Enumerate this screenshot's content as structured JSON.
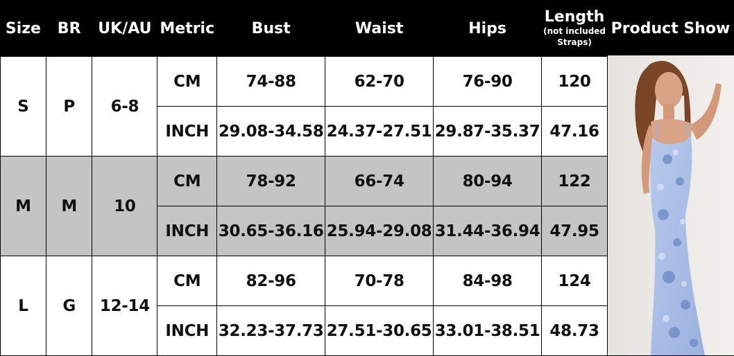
{
  "headers": {
    "size": "Size",
    "br": "BR",
    "ukau": "UK/AU",
    "metric": "Metric",
    "bust": "Bust",
    "waist": "Waist",
    "hips": "Hips",
    "length": "Length",
    "length_note_1": "(not included",
    "length_note_2": "Straps)",
    "product": "Product Show"
  },
  "rows": [
    {
      "size": "S",
      "br": "P",
      "ukau": "6-8",
      "cm": {
        "metric": "CM",
        "bust": "74-88",
        "waist": "62-70",
        "hips": "76-90",
        "length": "120"
      },
      "inch": {
        "metric": "INCH",
        "bust": "29.08-34.58",
        "waist": "24.37-27.51",
        "hips": "29.87-35.37",
        "length": "47.16"
      }
    },
    {
      "size": "M",
      "br": "M",
      "ukau": "10",
      "cm": {
        "metric": "CM",
        "bust": "78-92",
        "waist": "66-74",
        "hips": "80-94",
        "length": "122"
      },
      "inch": {
        "metric": "INCH",
        "bust": "30.65-36.16",
        "waist": "25.94-29.08",
        "hips": "31.44-36.94",
        "length": "47.95"
      }
    },
    {
      "size": "L",
      "br": "G",
      "ukau": "12-14",
      "cm": {
        "metric": "CM",
        "bust": "82-96",
        "waist": "70-78",
        "hips": "84-98",
        "length": "124"
      },
      "inch": {
        "metric": "INCH",
        "bust": "32.23-37.73",
        "waist": "27.51-30.65",
        "hips": "33.01-38.51",
        "length": "48.73"
      }
    }
  ],
  "colors": {
    "header_bg": "#000000",
    "header_text": "#ffffff",
    "stripe_bg": "#c4c4c4",
    "dress": "#a9bfe6"
  }
}
